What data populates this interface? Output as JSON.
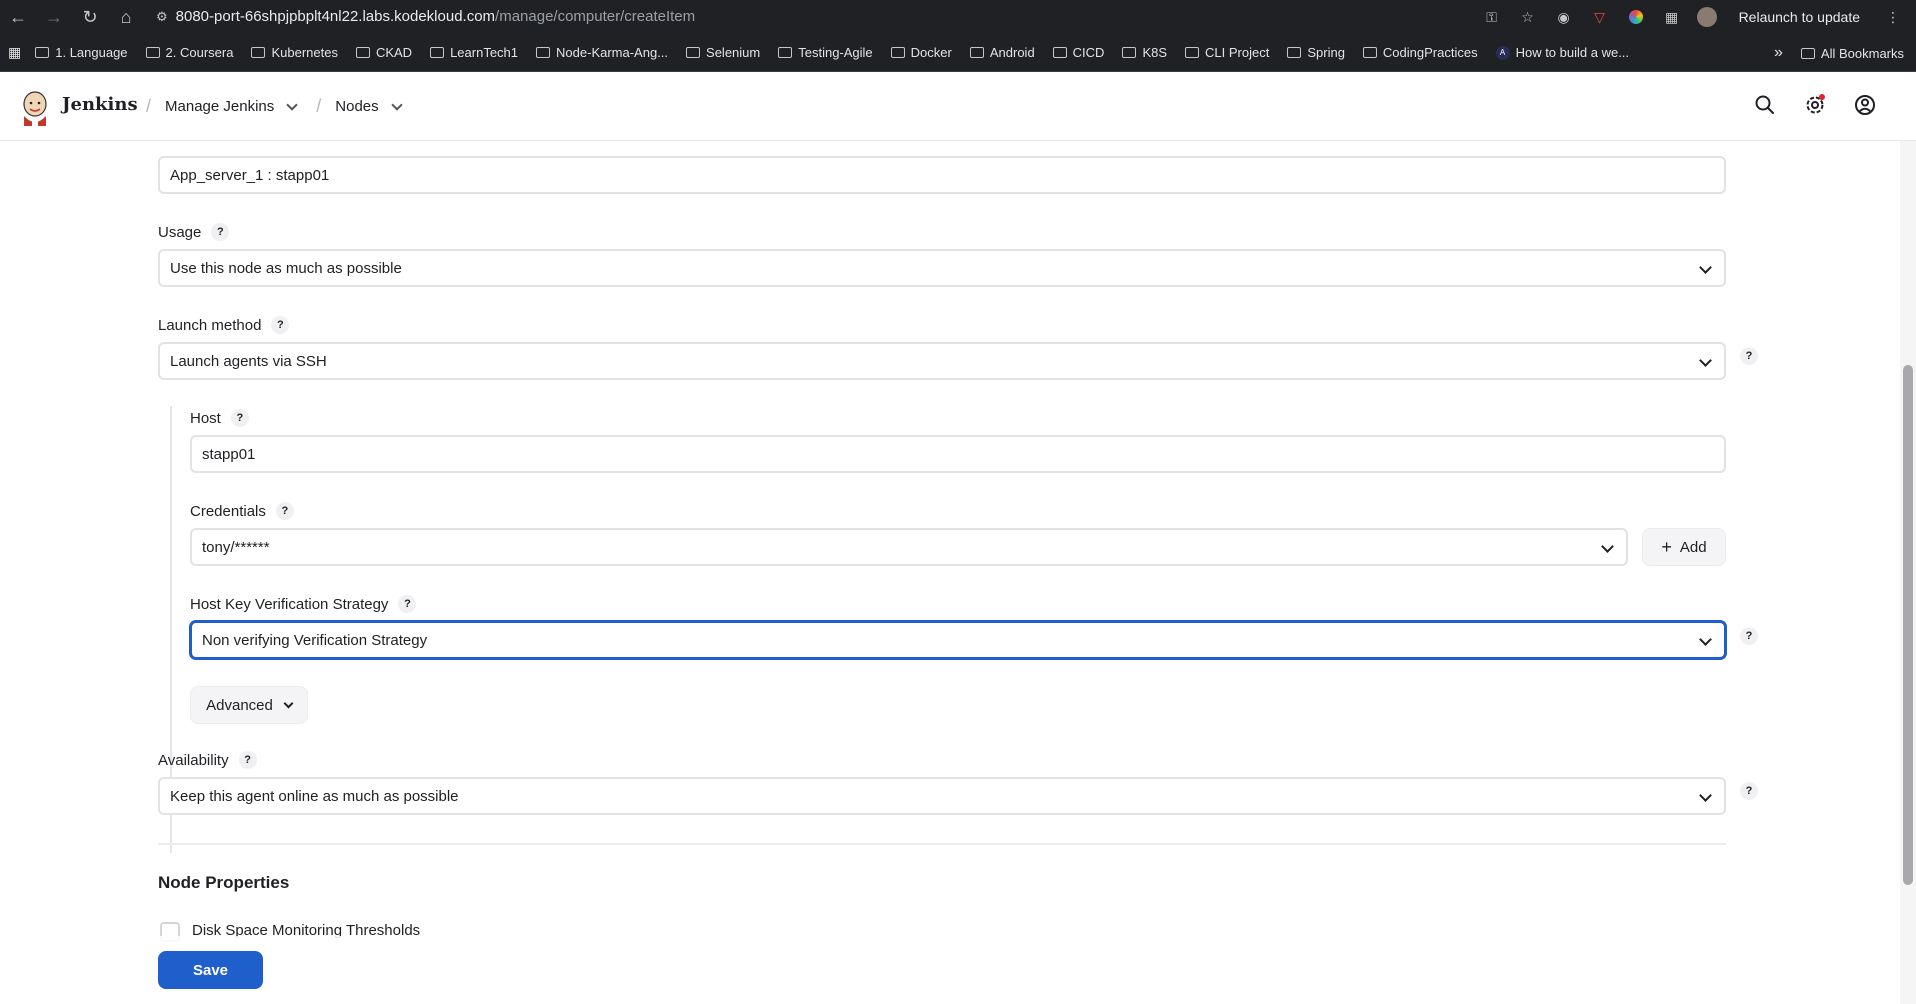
{
  "browser": {
    "url_host": "8080-port-66shpjpbplt4nl22.labs.kodekloud.com",
    "url_path": "/manage/computer/createItem",
    "relaunch_label": "Relaunch to update",
    "bookmarks": [
      "1. Language",
      "2. Coursera",
      "Kubernetes",
      "CKAD",
      "LearnTech1",
      "Node-Karma-Ang...",
      "Selenium",
      "Testing-Agile",
      "Docker",
      "Android",
      "CICD",
      "K8S",
      "CLI Project",
      "Spring",
      "CodingPractices",
      "How to build a we..."
    ],
    "all_bookmarks": "All Bookmarks",
    "overflow": "»"
  },
  "header": {
    "title": "Jenkins",
    "crumb1": "Manage Jenkins",
    "crumb2": "Nodes"
  },
  "form": {
    "labels_value": "App_server_1 : stapp01",
    "usage_label": "Usage",
    "usage_value": "Use this node as much as possible",
    "launch_label": "Launch method",
    "launch_value": "Launch agents via SSH",
    "host_label": "Host",
    "host_value": "stapp01",
    "cred_label": "Credentials",
    "cred_value": "tony/******",
    "add_label": "Add",
    "hkvs_label": "Host Key Verification Strategy",
    "hkvs_value": "Non verifying Verification Strategy",
    "advanced_label": "Advanced",
    "availability_label": "Availability",
    "availability_value": "Keep this agent online as much as possible",
    "node_props_title": "Node Properties",
    "disk_label": "Disk Space Monitoring Thresholds",
    "save_label": "Save",
    "help_glyph": "?"
  }
}
